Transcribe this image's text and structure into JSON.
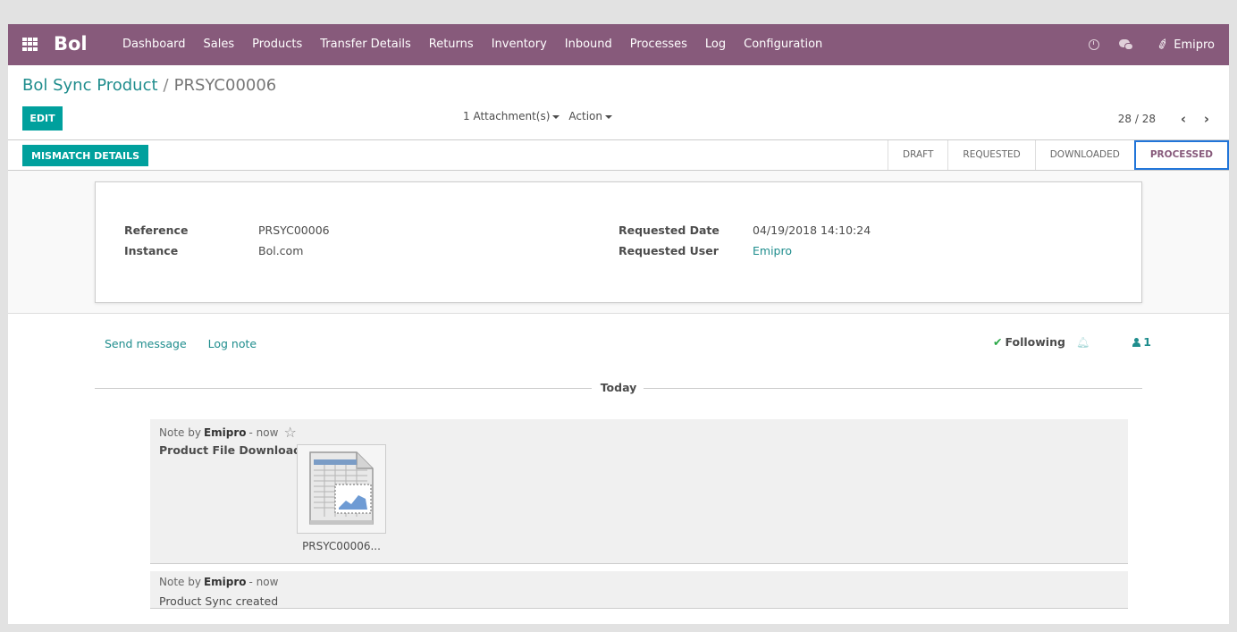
{
  "navbar": {
    "brand": "Bol",
    "menu": [
      "Dashboard",
      "Sales",
      "Products",
      "Transfer Details",
      "Returns",
      "Inventory",
      "Inbound",
      "Processes",
      "Log",
      "Configuration"
    ],
    "user": "Emipro",
    "icons": [
      "apps-icon",
      "clock-icon",
      "chat-icon",
      "phone-icon"
    ]
  },
  "breadcrumb": {
    "parent": "Bol Sync Product",
    "separator": "/",
    "current": "PRSYC00006"
  },
  "control": {
    "edit_label": "EDIT",
    "attachments_label": "1 Attachment(s)",
    "action_label": "Action",
    "pager": "28 / 28"
  },
  "statusbar": {
    "mismatch_label": "MISMATCH DETAILS",
    "stages": [
      "DRAFT",
      "REQUESTED",
      "DOWNLOADED",
      "PROCESSED"
    ],
    "active_stage": "PROCESSED"
  },
  "form": {
    "reference_label": "Reference",
    "reference_value": "PRSYC00006",
    "instance_label": "Instance",
    "instance_value": "Bol.com",
    "requested_date_label": "Requested Date",
    "requested_date_value": "04/19/2018 14:10:24",
    "requested_user_label": "Requested User",
    "requested_user_value": "Emipro"
  },
  "chatter": {
    "send_message": "Send message",
    "log_note": "Log note",
    "following": "Following",
    "followers_count": "1",
    "day_label": "Today",
    "messages": [
      {
        "prefix": "Note by",
        "author": "Emipro",
        "time": "- now",
        "body": "Product File Downloaded",
        "attachment": "PRSYC00006..."
      },
      {
        "prefix": "Note by",
        "author": "Emipro",
        "time": "- now",
        "body": "Product Sync created"
      }
    ]
  },
  "colors": {
    "navbar": "#875a7b",
    "primary_button": "#00a09d",
    "link": "#1f8d8d",
    "active_stage_border": "#2175d9"
  }
}
